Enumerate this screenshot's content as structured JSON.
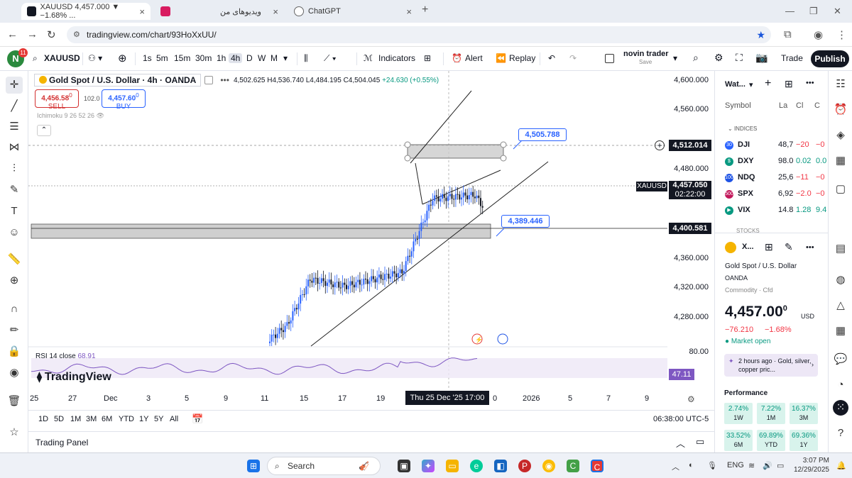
{
  "browser": {
    "tabs": [
      {
        "title": "XAUUSD 4,457.000 ▼ −1.68% ...",
        "active": true
      },
      {
        "title": "ویدیوهای من",
        "active": false
      },
      {
        "title": "ChatGPT",
        "active": false
      }
    ],
    "url": "tradingview.com/chart/93HoXxUU/"
  },
  "toolbar": {
    "avatar_letter": "N",
    "notifications": "11",
    "symbol": "XAUUSD",
    "intervals": [
      "1s",
      "5m",
      "15m",
      "30m",
      "1h",
      "4h",
      "D",
      "W",
      "M"
    ],
    "active_interval": "4h",
    "indicators_label": "Indicators",
    "alert_label": "Alert",
    "replay_label": "Replay",
    "layout_name": "novin trader",
    "layout_sub": "Save",
    "trade_label": "Trade",
    "publish_label": "Publish"
  },
  "legend": {
    "title": "Gold Spot / U.S. Dollar · 4h · OANDA",
    "o": "4,502.625",
    "h": "H4,536.740",
    "l": "L4,484.195",
    "c": "C4,504.045",
    "change": "+24.630 (+0.55%)",
    "sell_price": "4,456.58",
    "sell_sup": "0",
    "sell_label": "SELL",
    "spread": "102.0",
    "buy_price": "4,457.60",
    "buy_sup": "0",
    "buy_label": "BUY",
    "indicator": "Ichimoku 9 26 52 26"
  },
  "price_scale": {
    "ticks": [
      "4,600.000",
      "4,560.000",
      "4,520.000",
      "4,480.000",
      "4,440.000",
      "4,400.000",
      "4,360.000",
      "4,320.000",
      "4,280.000"
    ],
    "crosshair_price": "4,512.014",
    "last_price": "4,457.050",
    "countdown": "02:22:00",
    "zone_price": "4,400.581",
    "symbol_tag": "XAUUSD"
  },
  "annotations": {
    "upper_callout": "4,505.788",
    "lower_callout": "4,389.446"
  },
  "rsi": {
    "name": "RSI 14 close",
    "value_text": "68.91",
    "level_80": "80.00",
    "current": "47.11"
  },
  "watermark": "TradingView",
  "time_axis": {
    "ticks": [
      "25",
      "27",
      "Dec",
      "3",
      "5",
      "9",
      "11",
      "15",
      "17",
      "19",
      "0",
      "2026",
      "5",
      "7",
      "9"
    ],
    "crosshair_time": "Thu 25 Dec '25   17:00"
  },
  "range_bar": {
    "ranges": [
      "1D",
      "5D",
      "1M",
      "3M",
      "6M",
      "YTD",
      "1Y",
      "5Y",
      "All"
    ],
    "clock": "06:38:00 UTC-5"
  },
  "trading_panel": "Trading Panel",
  "watchlist": {
    "title": "Wat...",
    "columns": [
      "Symbol",
      "La",
      "Cl",
      "C"
    ],
    "section": "INDICES",
    "rows": [
      {
        "sym": "DJI",
        "last": "48,7",
        "chg": "−20",
        "chgp": "−0",
        "color": "#2962ff",
        "badge": "30"
      },
      {
        "sym": "DXY",
        "last": "98.0",
        "chg": "0.02",
        "chgp": "0.0",
        "color": "#089981",
        "badge": "$"
      },
      {
        "sym": "NDQ",
        "last": "25,6",
        "chg": "−11",
        "chgp": "−0",
        "color": "#1e53e5",
        "badge": "100"
      },
      {
        "sym": "SPX",
        "last": "6,92",
        "chg": "−2.0",
        "chgp": "−0",
        "color": "#c2185b",
        "badge": "500"
      },
      {
        "sym": "VIX",
        "last": "14.8",
        "chg": "1.28",
        "chgp": "9.4",
        "color": "#089981",
        "badge": "▶"
      }
    ],
    "next_section": "STOCKS"
  },
  "details": {
    "short": "X...",
    "name": "Gold Spot / U.S. Dollar",
    "exchange": "OANDA",
    "category": "Commodity · Cfd",
    "price": "4,457.00",
    "price_sup": "0",
    "currency": "USD",
    "change": "−76.210",
    "change_pct": "−1.68%",
    "status": "Market open",
    "news": "2 hours ago · Gold, silver, copper pric...",
    "performance_title": "Performance",
    "performance": [
      {
        "value": "2.74%",
        "period": "1W"
      },
      {
        "value": "7.22%",
        "period": "1M"
      },
      {
        "value": "16.37%",
        "period": "3M"
      },
      {
        "value": "33.52%",
        "period": "6M"
      },
      {
        "value": "69.89%",
        "period": "YTD"
      },
      {
        "value": "69.36%",
        "period": "1Y"
      }
    ]
  },
  "taskbar": {
    "search_label": "Search",
    "lang": "ENG",
    "time": "3:07 PM",
    "date": "12/29/2025"
  }
}
